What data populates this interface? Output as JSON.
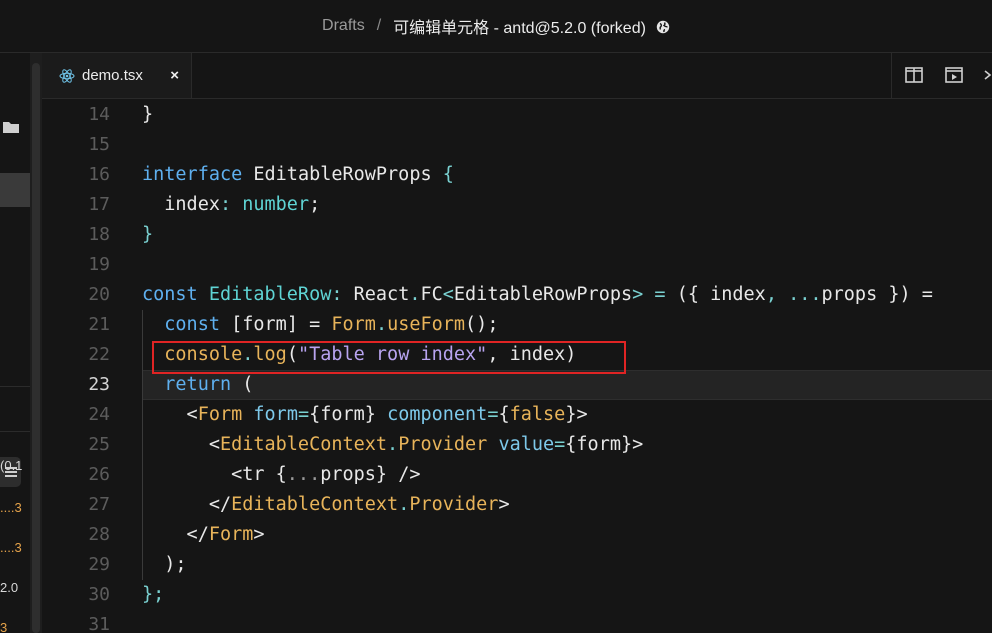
{
  "title_bar": {
    "crumb_root": "Drafts",
    "separator": "/",
    "sandbox_title": "可编辑单元格 - antd@5.2.0 (forked)"
  },
  "sidebar": {
    "dependency_fragments": [
      {
        "text": "0.1)",
        "color": "#d8d8d8"
      },
      {
        "text": "3....",
        "color": "#e4a24a"
      },
      {
        "text": "3....",
        "color": "#e4a24a"
      },
      {
        "text": "2.0",
        "color": "#d8d8d8"
      },
      {
        "text": "3",
        "color": "#e4a24a"
      }
    ]
  },
  "tabs": [
    {
      "label": "demo.tsx",
      "icon": "react-icon",
      "close": "×"
    }
  ],
  "editor": {
    "active_line": 23,
    "lines": [
      {
        "n": "14",
        "tokens": [
          {
            "t": "}",
            "c": "w"
          }
        ]
      },
      {
        "n": "15",
        "tokens": []
      },
      {
        "n": "16",
        "tokens": [
          {
            "t": "interface ",
            "c": "k"
          },
          {
            "t": "EditableRowProps ",
            "c": "w"
          },
          {
            "t": "{",
            "c": "p"
          }
        ]
      },
      {
        "n": "17",
        "tokens": [
          {
            "t": "  index",
            "c": "w"
          },
          {
            "t": ": ",
            "c": "p"
          },
          {
            "t": "number",
            "c": "t"
          },
          {
            "t": ";",
            "c": "w"
          }
        ]
      },
      {
        "n": "18",
        "tokens": [
          {
            "t": "}",
            "c": "p"
          }
        ]
      },
      {
        "n": "19",
        "tokens": []
      },
      {
        "n": "20",
        "tokens": [
          {
            "t": "const ",
            "c": "k"
          },
          {
            "t": "EditableRow",
            "c": "t"
          },
          {
            "t": ": ",
            "c": "p"
          },
          {
            "t": "React",
            "c": "w"
          },
          {
            "t": ".",
            "c": "p"
          },
          {
            "t": "FC",
            "c": "w"
          },
          {
            "t": "<",
            "c": "p"
          },
          {
            "t": "EditableRowProps",
            "c": "w"
          },
          {
            "t": "> = ",
            "c": "p"
          },
          {
            "t": "({ ",
            "c": "w"
          },
          {
            "t": "index",
            "c": "w"
          },
          {
            "t": ", ",
            "c": "p"
          },
          {
            "t": "...",
            "c": "p"
          },
          {
            "t": "props ",
            "c": "w"
          },
          {
            "t": "}) =",
            "c": "w"
          }
        ]
      },
      {
        "n": "21",
        "tokens": [
          {
            "t": "  const ",
            "c": "k"
          },
          {
            "t": "[",
            "c": "w"
          },
          {
            "t": "form",
            "c": "w"
          },
          {
            "t": "] = ",
            "c": "w"
          },
          {
            "t": "Form",
            "c": "f"
          },
          {
            "t": ".",
            "c": "p"
          },
          {
            "t": "useForm",
            "c": "f"
          },
          {
            "t": "();",
            "c": "w"
          }
        ]
      },
      {
        "n": "22",
        "tokens": [
          {
            "t": "  console",
            "c": "f"
          },
          {
            "t": ".",
            "c": "p"
          },
          {
            "t": "log",
            "c": "f"
          },
          {
            "t": "(",
            "c": "w"
          },
          {
            "t": "\"Table row index\"",
            "c": "s"
          },
          {
            "t": ", index)",
            "c": "w"
          }
        ]
      },
      {
        "n": "23",
        "tokens": [
          {
            "t": "  return ",
            "c": "k"
          },
          {
            "t": "(",
            "c": "w"
          }
        ]
      },
      {
        "n": "24",
        "tokens": [
          {
            "t": "    <",
            "c": "w"
          },
          {
            "t": "Form ",
            "c": "f"
          },
          {
            "t": "form",
            "c": "a"
          },
          {
            "t": "=",
            "c": "p"
          },
          {
            "t": "{form} ",
            "c": "w"
          },
          {
            "t": "component",
            "c": "a"
          },
          {
            "t": "=",
            "c": "p"
          },
          {
            "t": "{",
            "c": "w"
          },
          {
            "t": "false",
            "c": "f"
          },
          {
            "t": "}>",
            "c": "w"
          }
        ]
      },
      {
        "n": "25",
        "tokens": [
          {
            "t": "      <",
            "c": "w"
          },
          {
            "t": "EditableContext",
            "c": "f"
          },
          {
            "t": ".",
            "c": "p"
          },
          {
            "t": "Provider ",
            "c": "f"
          },
          {
            "t": "value",
            "c": "a"
          },
          {
            "t": "=",
            "c": "p"
          },
          {
            "t": "{form}>",
            "c": "w"
          }
        ]
      },
      {
        "n": "26",
        "tokens": [
          {
            "t": "        <tr ",
            "c": "w"
          },
          {
            "t": "{",
            "c": "w"
          },
          {
            "t": "...",
            "c": "d"
          },
          {
            "t": "props",
            "c": "w"
          },
          {
            "t": "} />",
            "c": "w"
          }
        ]
      },
      {
        "n": "27",
        "tokens": [
          {
            "t": "      </",
            "c": "w"
          },
          {
            "t": "EditableContext",
            "c": "f"
          },
          {
            "t": ".",
            "c": "p"
          },
          {
            "t": "Provider",
            "c": "f"
          },
          {
            "t": ">",
            "c": "w"
          }
        ]
      },
      {
        "n": "28",
        "tokens": [
          {
            "t": "    </",
            "c": "w"
          },
          {
            "t": "Form",
            "c": "f"
          },
          {
            "t": ">",
            "c": "w"
          }
        ]
      },
      {
        "n": "29",
        "tokens": [
          {
            "t": "  );",
            "c": "w"
          }
        ]
      },
      {
        "n": "30",
        "tokens": [
          {
            "t": "};",
            "c": "p"
          }
        ]
      },
      {
        "n": "31",
        "tokens": []
      }
    ]
  }
}
